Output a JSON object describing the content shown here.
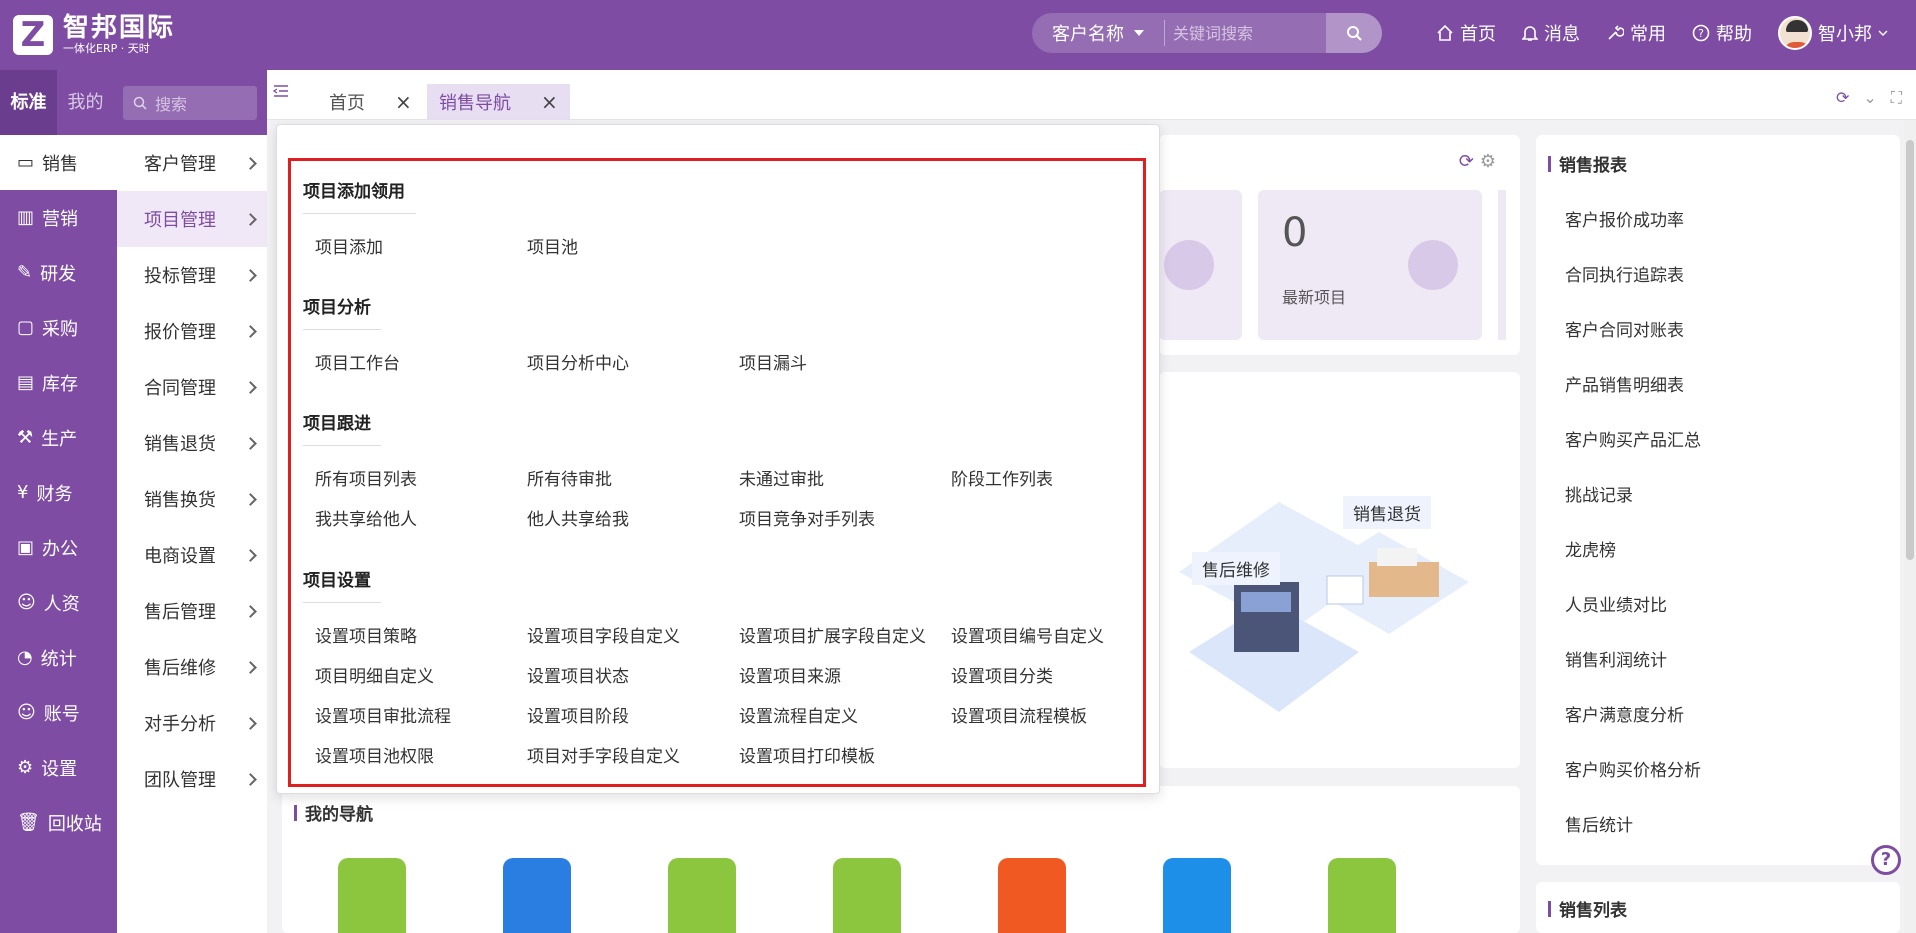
{
  "logo": {
    "letter": "Z",
    "name": "智邦国际",
    "tagline": "一体化ERP · 天时"
  },
  "search": {
    "type": "客户名称",
    "placeholder": "关键词搜索"
  },
  "topnav": [
    {
      "label": "首页",
      "icon": "home-icon"
    },
    {
      "label": "消息",
      "icon": "bell-icon"
    },
    {
      "label": "常用",
      "icon": "wrench-icon"
    },
    {
      "label": "帮助",
      "icon": "help-icon"
    }
  ],
  "user": {
    "name": "智小邦"
  },
  "side_tabs": {
    "standard": "标准",
    "mine": "我的",
    "search_placeholder": "搜索"
  },
  "main_menu": [
    {
      "label": "销售",
      "icon": "chat-icon",
      "active": true
    },
    {
      "label": "营销",
      "icon": "chart-icon"
    },
    {
      "label": "研发",
      "icon": "design-icon"
    },
    {
      "label": "采购",
      "icon": "basket-icon"
    },
    {
      "label": "库存",
      "icon": "warehouse-icon"
    },
    {
      "label": "生产",
      "icon": "factory-icon"
    },
    {
      "label": "财务",
      "icon": "yen-icon"
    },
    {
      "label": "办公",
      "icon": "briefcase-icon"
    },
    {
      "label": "人资",
      "icon": "person-icon"
    },
    {
      "label": "统计",
      "icon": "pie-icon"
    },
    {
      "label": "账号",
      "icon": "account-icon"
    },
    {
      "label": "设置",
      "icon": "settings-icon"
    },
    {
      "label": "回收站",
      "icon": "trash-icon"
    }
  ],
  "sub_menu": [
    "客户管理",
    "项目管理",
    "投标管理",
    "报价管理",
    "合同管理",
    "销售退货",
    "销售换货",
    "电商设置",
    "售后管理",
    "售后维修",
    "对手分析",
    "团队管理"
  ],
  "tabs": [
    {
      "label": "首页"
    },
    {
      "label": "销售导航",
      "active": true
    }
  ],
  "tab_close": "×",
  "stats": {
    "value": "0",
    "label": "最新项目"
  },
  "illustration": {
    "label1": "售后维修",
    "label2": "销售退货"
  },
  "my_nav": {
    "title": "我的导航"
  },
  "report": {
    "title": "销售报表",
    "items": [
      "客户报价成功率",
      "合同执行追踪表",
      "客户合同对账表",
      "产品销售明细表",
      "客户购买产品汇总",
      "挑战记录",
      "龙虎榜",
      "人员业绩对比",
      "销售利润统计",
      "客户满意度分析",
      "客户购买价格分析",
      "售后统计"
    ]
  },
  "list_card": {
    "title": "销售列表"
  },
  "help_mark": "?",
  "dropdown": {
    "sections": [
      {
        "title": "项目添加领用",
        "links": [
          [
            "项目添加",
            "项目池"
          ]
        ]
      },
      {
        "title": "项目分析",
        "links": [
          [
            "项目工作台",
            "项目分析中心",
            "项目漏斗"
          ]
        ]
      },
      {
        "title": "项目跟进",
        "links": [
          [
            "所有项目列表",
            "所有待审批",
            "未通过审批",
            "阶段工作列表"
          ],
          [
            "我共享给他人",
            "他人共享给我",
            "项目竞争对手列表"
          ]
        ]
      },
      {
        "title": "项目设置",
        "links": [
          [
            "设置项目策略",
            "设置项目字段自定义",
            "设置项目扩展字段自定义",
            "设置项目编号自定义"
          ],
          [
            "项目明细自定义",
            "设置项目状态",
            "设置项目来源",
            "设置项目分类"
          ],
          [
            "设置项目审批流程",
            "设置项目阶段",
            "设置流程自定义",
            "设置项目流程模板"
          ],
          [
            "设置项目池权限",
            "项目对手字段自定义",
            "设置项目打印模板"
          ]
        ]
      }
    ]
  },
  "colors": {
    "brand": "#7e4da3",
    "highlight": "#e02020"
  }
}
